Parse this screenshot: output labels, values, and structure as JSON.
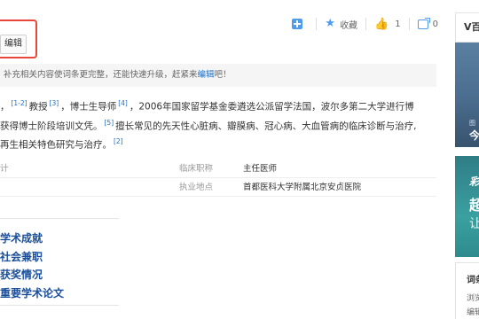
{
  "header": {
    "edit_label": "编辑"
  },
  "toolbar": {
    "add_label": "",
    "favorite_label": "收藏",
    "like_count": "1",
    "share_count": "0"
  },
  "notice": {
    "text": "补充相关内容使词条更完整，还能快速升级，赶紧来",
    "link": "编辑",
    "suffix": "吧！"
  },
  "paragraph": {
    "line1_a": "，",
    "ref1": "[1-2]",
    "line1_b": "教授",
    "ref2": "[3]",
    "line1_c": "，博士生导师",
    "ref3": "[4]",
    "line1_d": "，2006年国家留学基金委遴选公派留学法国，波尔多第二大学进行博",
    "line2_a": "获得博士阶段培训文凭。",
    "ref4": "[5]",
    "line2_b": "擅长常见的先天性心脏病、瓣膜病、冠心病、大血管病的临床诊断与治疗,",
    "line3_a": "再生相关特色研究与治疗。",
    "ref5": "[2]"
  },
  "info": {
    "row1_left": "计",
    "row1_label": "临床职称",
    "row1_value": "主任医师",
    "row2_label": "执业地点",
    "row2_value": "首都医科大学附属北京安贞医院"
  },
  "toc": {
    "items": [
      "学术成就",
      "社会兼职",
      "获奖情况",
      "重要学术论文"
    ]
  },
  "sidebar": {
    "head": "V百",
    "img1_caption_small": "图",
    "img1_caption": "今",
    "img2_t1": "彩",
    "img2_t2": "超",
    "img2_t3": "让",
    "box_head": "词条",
    "box_l1": "浏览",
    "box_l2": "编辑"
  },
  "colors": {
    "accent": "#4f9cee",
    "link": "#1b6fc9",
    "highlight_border": "#e8473c"
  }
}
